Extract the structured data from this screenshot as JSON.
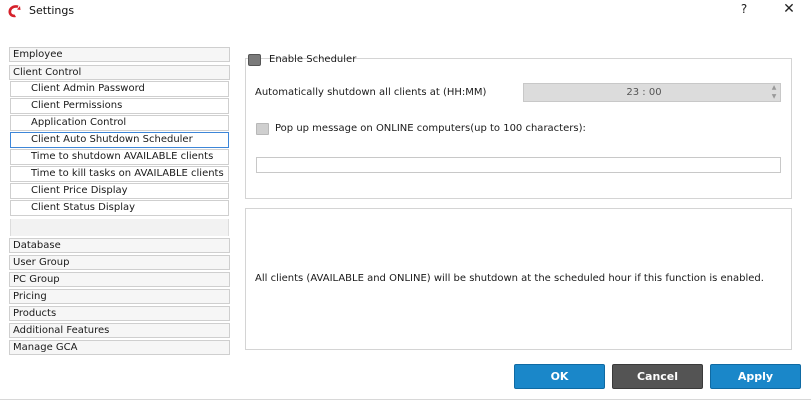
{
  "window": {
    "title": "Settings",
    "help": "?",
    "close": "✕"
  },
  "nav": {
    "employee": "Employee",
    "client_control": "Client Control",
    "client_control_items": [
      "Client Admin Password",
      "Client Permissions",
      "Application Control",
      "Client Auto Shutdown Scheduler",
      "Time to shutdown AVAILABLE clients",
      "Time to kill tasks on AVAILABLE clients",
      "Client Price Display",
      "Client Status Display"
    ],
    "selected_item": "Client Auto Shutdown Scheduler",
    "sections": [
      "Database",
      "User Group",
      "PC Group",
      "Pricing",
      "Products",
      "Additional Features",
      "Manage GCA"
    ]
  },
  "scheduler": {
    "enable_label": "Enable Scheduler",
    "enabled": false,
    "shutdown_label": "Automatically shutdown all clients at (HH:MM)",
    "time_value": "23 : 00",
    "popup_label": "Pop up message on ONLINE computers(up to 100 characters):",
    "popup_checked": false,
    "message_value": ""
  },
  "info": {
    "text": "All clients (AVAILABLE and ONLINE) will be shutdown at the scheduled hour if this function is enabled."
  },
  "buttons": {
    "ok": "OK",
    "cancel": "Cancel",
    "apply": "Apply"
  },
  "colors": {
    "primary_button": "#1a87c9",
    "secondary_button": "#545454",
    "selection_border": "#3d86d8",
    "app_icon": "#d6202a"
  },
  "icons": {
    "app": "app-logo-icon",
    "spin_up": "chevron-up-icon",
    "spin_down": "chevron-down-icon"
  }
}
